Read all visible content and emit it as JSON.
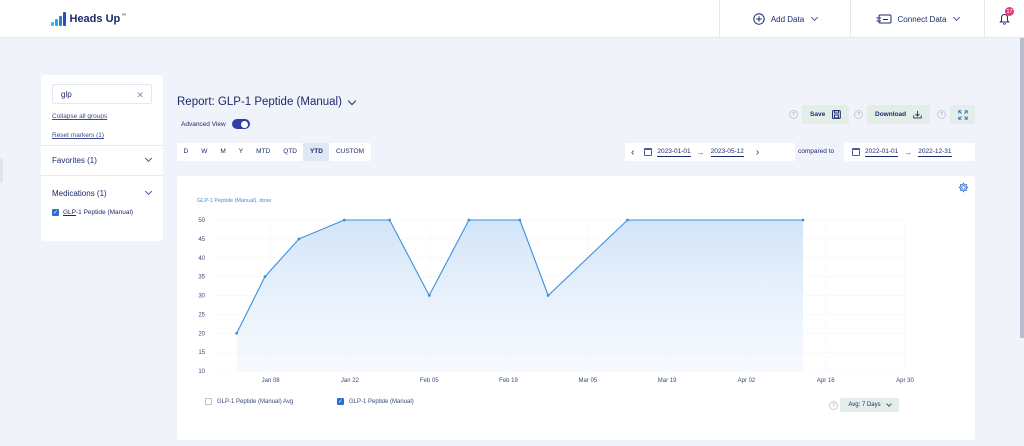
{
  "app": {
    "name": "Heads Up",
    "trademark": "™"
  },
  "header": {
    "add_data_label": "Add Data",
    "connect_data_label": "Connect Data",
    "notification_count": "17"
  },
  "sidebar": {
    "search_value": "glp",
    "collapse_label": "Collapse all groups",
    "reset_label": "Reset markers (1)",
    "groups": [
      {
        "label": "Favorites (1)"
      },
      {
        "label": "Medications (1)"
      }
    ],
    "med_item": {
      "prefix": "GLP",
      "suffix": "-1 Peptide (Manual)"
    }
  },
  "report": {
    "title": "Report: GLP-1 Peptide (Manual)",
    "advanced_view_label": "Advanced View",
    "save_label": "Save",
    "download_label": "Download",
    "range_tabs": [
      "D",
      "W",
      "M",
      "Y",
      "MTD",
      "QTD",
      "YTD",
      "CUSTOM"
    ],
    "active_tab": "YTD",
    "date_start": "2023-01-01",
    "date_end": "2023-05-12",
    "compared_to_label": "compared to",
    "compare_start": "2022-01-01",
    "compare_end": "2022-12-31",
    "avg_label": "Avg: 7 Days",
    "legend": [
      {
        "label": "GLP-1 Peptide (Manual) Avg",
        "checked": false
      },
      {
        "label": "GLP-1 Peptide (Manual)",
        "checked": true
      }
    ]
  },
  "colors": {
    "accent": "#3a8fe0",
    "navy": "#1d2a6b",
    "fill": "#d8e8fa"
  },
  "chart_data": {
    "type": "area",
    "series_label": "GLP-1 Peptide (Manual), dose",
    "x_ticks": [
      "Jan 08",
      "Jan 22",
      "Feb 05",
      "Feb 19",
      "Mar 05",
      "Mar 19",
      "Apr 02",
      "Apr 16",
      "Apr 30"
    ],
    "y_ticks": [
      10,
      15,
      20,
      25,
      30,
      35,
      40,
      45,
      50
    ],
    "ylim": [
      10,
      50
    ],
    "x_range_days": [
      -3,
      119
    ],
    "series": [
      {
        "name": "GLP-1 Peptide (Manual)",
        "points": [
          {
            "x": "2023-01-02",
            "y": 20
          },
          {
            "x": "2023-01-07",
            "y": 35
          },
          {
            "x": "2023-01-13",
            "y": 45
          },
          {
            "x": "2023-01-21",
            "y": 50
          },
          {
            "x": "2023-01-29",
            "y": 50
          },
          {
            "x": "2023-02-05",
            "y": 30
          },
          {
            "x": "2023-02-12",
            "y": 50
          },
          {
            "x": "2023-02-21",
            "y": 50
          },
          {
            "x": "2023-02-26",
            "y": 30
          },
          {
            "x": "2023-03-12",
            "y": 50
          },
          {
            "x": "2023-04-12",
            "y": 50
          }
        ]
      }
    ]
  }
}
